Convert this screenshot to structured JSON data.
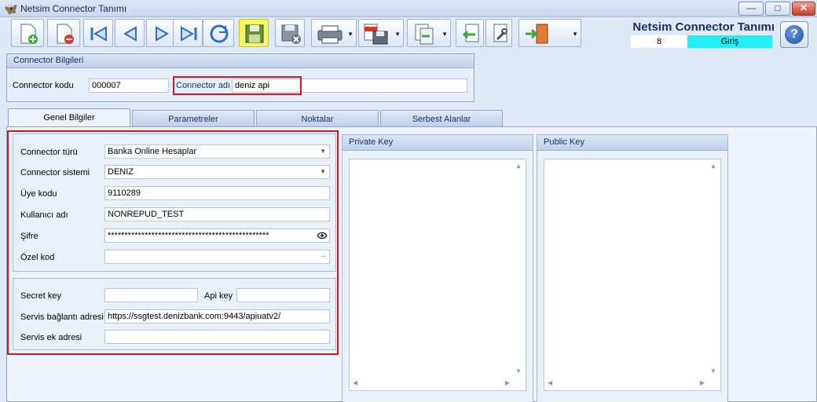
{
  "window": {
    "title": "Netsim Connector Tanımı",
    "minimize": "—",
    "maximize": "□",
    "close": "✕"
  },
  "toolbar": {
    "dropdown_glyph": "▼"
  },
  "header": {
    "form_title": "Netsim Connector Tanımı",
    "record_no": "8",
    "mode": "Giriş",
    "help": "?"
  },
  "connector_info": {
    "title": "Connector Bilgileri",
    "code_label": "Connector kodu",
    "code_value": "000007",
    "name_label": "Connector adı",
    "name_value": "deniz api"
  },
  "tabs": [
    {
      "label": "Genel Bilgiler"
    },
    {
      "label": "Parametreler"
    },
    {
      "label": "Noktalar"
    },
    {
      "label": "Serbest Alanlar"
    }
  ],
  "general": {
    "type_label": "Connector türü",
    "type_value": "Banka Online Hesaplar",
    "system_label": "Connector sistemi",
    "system_value": "DENIZ",
    "member_label": "Üye kodu",
    "member_value": "9110289",
    "user_label": "Kullanıcı adı",
    "user_value": "NONREPUD_TEST",
    "password_label": "Şifre",
    "password_value": "************************************************",
    "special_label": "Özel kod",
    "special_value": "",
    "special_ellipsis": "...",
    "secret_label": "Secret key",
    "secret_value": "",
    "api_label": "Api key",
    "api_value": "",
    "url_label": "Servis bağlantı adresi",
    "url_value": "https://ssgtest.denizbank.com:9443/apiuatv2/",
    "extra_label": "Servis ek adresi",
    "extra_value": ""
  },
  "keys": {
    "private_title": "Private Key",
    "public_title": "Public Key"
  },
  "colors": {
    "highlight": "#e0141f",
    "mode_badge": "#22f0f2",
    "save_button": "#f3f56a"
  }
}
